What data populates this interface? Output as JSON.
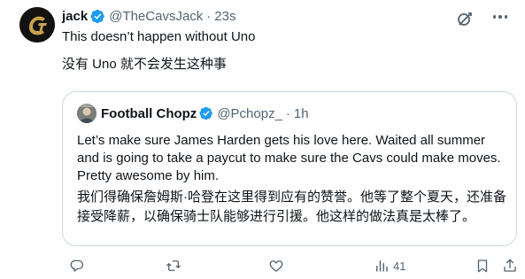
{
  "tweet": {
    "author_name": "jack",
    "author_handle": "@TheCavsJack",
    "separator": "·",
    "time": "23s",
    "text_en": "This doesn’t happen without Uno",
    "text_zh": "没有 Uno 就不会发生这种事",
    "verified": true
  },
  "quote": {
    "author_name": "Football Chopz",
    "author_handle": "@Pchopz_",
    "separator": "·",
    "time": "1h",
    "text_en": "Let’s make sure James Harden gets his love here. Waited all summer and is going to take a paycut to make sure the Cavs could make moves. Pretty awesome by him.",
    "text_zh": "我们得确保詹姆斯·哈登在这里得到应有的赞誉。他等了整个夏天，还准备接受降薪，以确保骑士队能够进行引援。他这样的做法真是太棒了。",
    "verified": true
  },
  "actions": {
    "reply_icon": "reply-icon",
    "retweet_icon": "retweet-icon",
    "like_icon": "heart-icon",
    "views_icon": "views-icon",
    "views_count": "41",
    "bookmark_icon": "bookmark-icon",
    "share_icon": "share-icon"
  },
  "colors": {
    "text": "#0f1419",
    "secondary": "#536471",
    "verified": "#1d9bf0",
    "border": "#cfd9de",
    "avatar_gold": "#c8a24a"
  }
}
